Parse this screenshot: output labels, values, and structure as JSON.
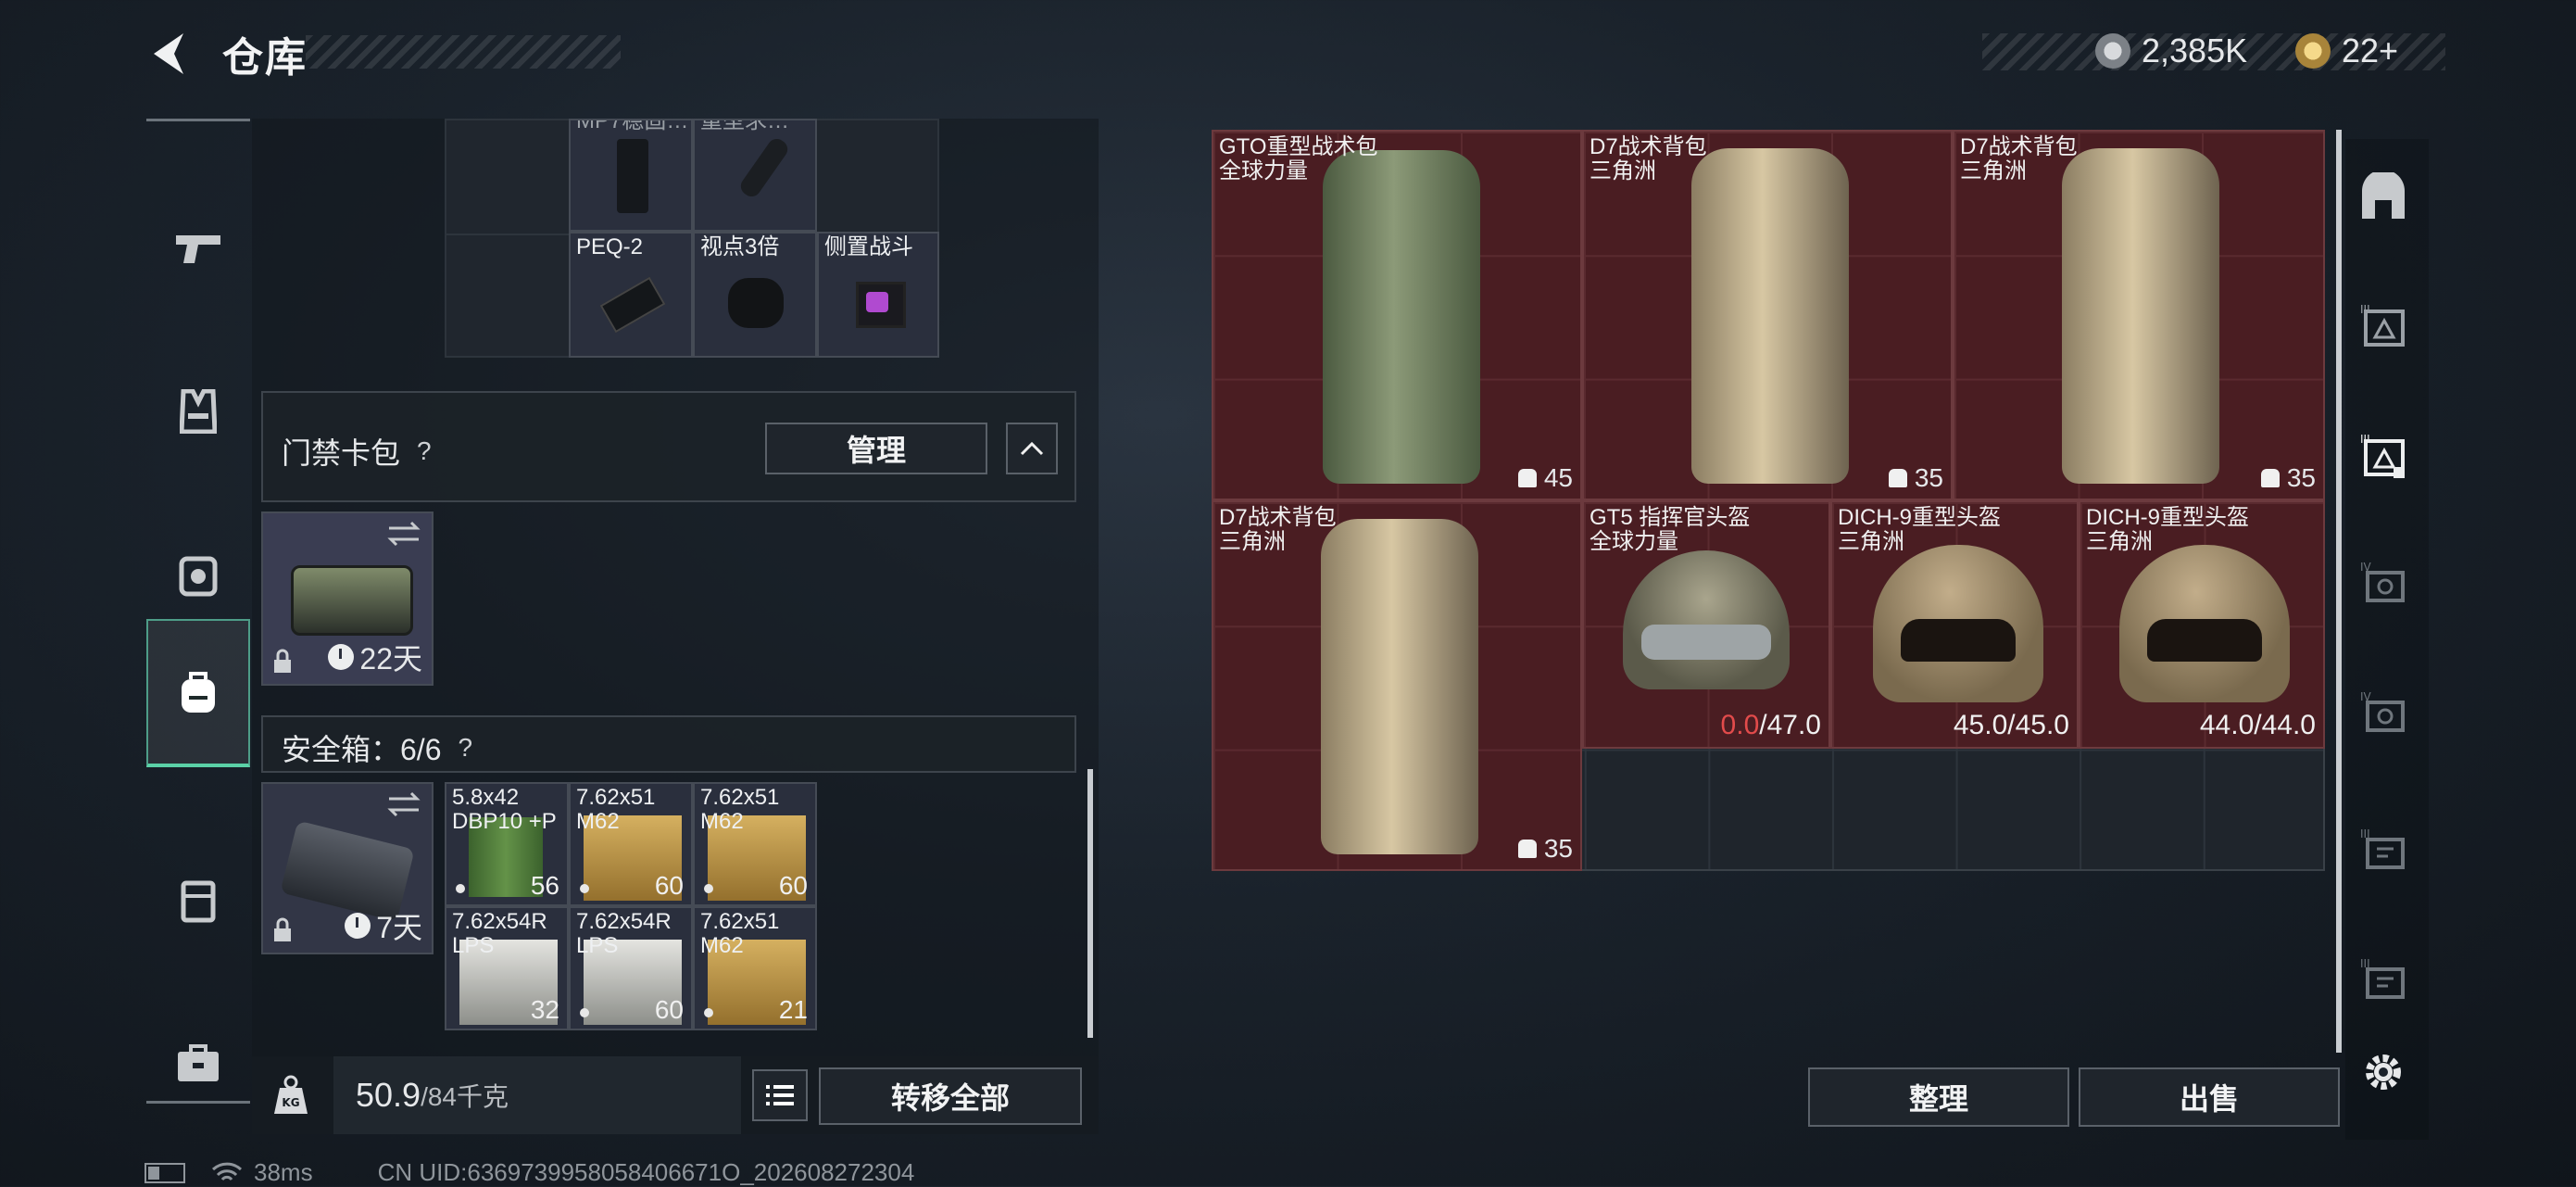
{
  "header": {
    "title": "仓库",
    "currency_silver": "2,385K",
    "currency_gold": "22+"
  },
  "colors": {
    "accent_green": "#5bd1a7",
    "item_red_bg": "#4a1d22",
    "durability_low": "#e24b4b"
  },
  "left_rail": [
    {
      "icon": "pistol-icon"
    },
    {
      "icon": "vest-icon"
    },
    {
      "icon": "chest-rig-icon"
    },
    {
      "icon": "backpack-icon",
      "active": true
    },
    {
      "icon": "case-icon"
    },
    {
      "icon": "toolbox-icon"
    }
  ],
  "top_grid": {
    "partial_labels": [
      "MP7稳固…",
      "重型求…"
    ],
    "items": [
      {
        "label": "PEQ-2"
      },
      {
        "label": "视点3倍"
      },
      {
        "label": "侧置战斗"
      }
    ]
  },
  "keycard": {
    "title": "门禁卡包",
    "help": "?",
    "manage_button": "管理",
    "timer": "22天"
  },
  "safe_box": {
    "title": "安全箱：6/6",
    "help": "?",
    "timer": "7天",
    "items": [
      {
        "label": "5.8x42\nDBP10 +P",
        "count": "56"
      },
      {
        "label": "7.62x51\nM62",
        "count": "60"
      },
      {
        "label": "7.62x51\nM62",
        "count": "60"
      },
      {
        "label": "7.62x54R\nLPS",
        "count": "32"
      },
      {
        "label": "7.62x54R\nLPS",
        "count": "60"
      },
      {
        "label": "7.62x51\nM62",
        "count": "21"
      }
    ]
  },
  "weight": {
    "current": "50.9",
    "max_unit": "/84千克",
    "transfer_all": "转移全部"
  },
  "stash": {
    "items": [
      {
        "name": "GTO重型战术包",
        "source": "全球力量",
        "count": "45"
      },
      {
        "name": "D7战术背包",
        "source": "三角洲",
        "count": "35"
      },
      {
        "name": "D7战术背包",
        "source": "三角洲",
        "count": "35"
      },
      {
        "name": "D7战术背包",
        "source": "三角洲",
        "count": "35"
      },
      {
        "name": "GT5 指挥官头盔",
        "source": "全球力量",
        "dur_current": "0.0",
        "dur_max": "/47.0"
      },
      {
        "name": "DICH-9重型头盔",
        "source": "三角洲",
        "durability": "45.0/45.0"
      },
      {
        "name": "DICH-9重型头盔",
        "source": "三角洲",
        "durability": "44.0/44.0"
      }
    ],
    "sort_button": "整理",
    "sell_button": "出售"
  },
  "right_rail": [
    {
      "icon": "stash-home-icon"
    },
    {
      "icon": "container-tier3-icon"
    },
    {
      "icon": "container-tier3-locked-icon"
    },
    {
      "icon": "container-tier4-icon"
    },
    {
      "icon": "container-tier4-icon"
    },
    {
      "icon": "container-tier3-icon"
    },
    {
      "icon": "container-tier3-icon"
    },
    {
      "icon": "settings-gear-icon"
    }
  ],
  "status_bar": {
    "ping": "38ms",
    "uid": "CN UID:6369739958058406671O_202608272304"
  }
}
